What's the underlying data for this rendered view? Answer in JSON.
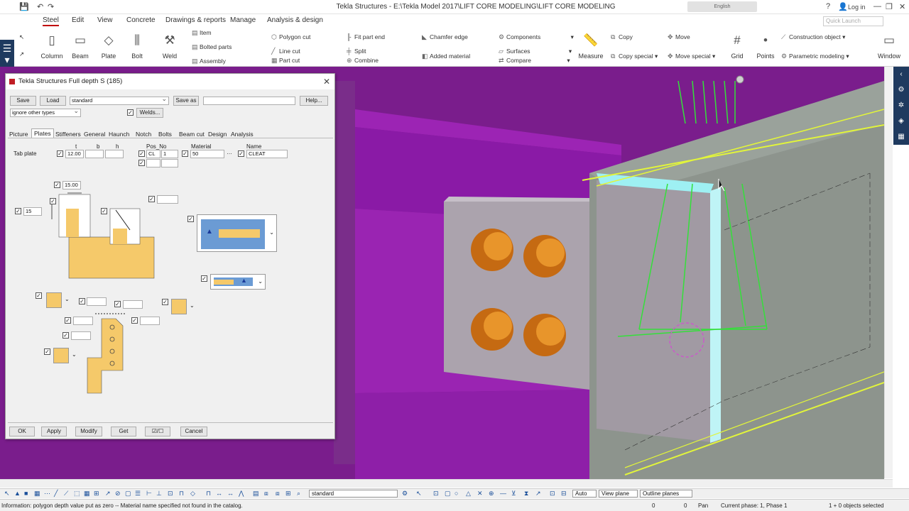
{
  "window": {
    "title": "Tekla Structures - E:\\Tekla Model 2017\\LIFT CORE MODELING\\LIFT CORE MODELING",
    "language": "English",
    "login": "Log in",
    "help": "?",
    "minimize": "—",
    "restore": "❐",
    "close": "✕"
  },
  "tabs": [
    "Steel",
    "Edit",
    "View",
    "Concrete",
    "Drawings & reports",
    "Manage",
    "Analysis & design"
  ],
  "search": {
    "placeholder": "Quick Launch"
  },
  "ribbon": {
    "big": [
      {
        "label": "Column",
        "icon": "column-icon",
        "glyph": "▯"
      },
      {
        "label": "Beam",
        "icon": "beam-icon",
        "glyph": "▭"
      },
      {
        "label": "Plate",
        "icon": "plate-icon",
        "glyph": "◇"
      },
      {
        "label": "Bolt",
        "icon": "bolt-icon",
        "glyph": "⫼"
      },
      {
        "label": "Weld",
        "icon": "weld-icon",
        "glyph": "⚒"
      },
      {
        "label": "Measure",
        "icon": "measure-icon",
        "glyph": "📏"
      },
      {
        "label": "Grid",
        "icon": "grid-icon",
        "glyph": "#"
      },
      {
        "label": "Points",
        "icon": "points-icon",
        "glyph": "•"
      },
      {
        "label": "Window",
        "icon": "window-icon",
        "glyph": "▭"
      }
    ],
    "small": {
      "item": "Item",
      "bolted_parts": "Bolted parts",
      "assembly": "Assembly",
      "polygon_cut": "Polygon cut",
      "line_cut": "Line cut",
      "part_cut": "Part cut",
      "fit_part_end": "Fit part end",
      "split": "Split",
      "combine": "Combine",
      "chamfer_edge": "Chamfer edge",
      "added_material": "Added material",
      "components": "Components",
      "surfaces": "Surfaces",
      "compare": "Compare",
      "copy": "Copy",
      "copy_special": "Copy special",
      "move": "Move",
      "move_special": "Move special",
      "construction_object": "Construction object",
      "parametric_modeling": "Parametric modeling"
    }
  },
  "dialog": {
    "title": "Tekla Structures  Full depth S (185)",
    "save": "Save",
    "load": "Load",
    "preset": "standard",
    "save_as": "Save as",
    "save_as_value": "",
    "help": "Help...",
    "ignore": "ignore other types",
    "welds": "Welds...",
    "tabs": [
      "Picture",
      "Plates",
      "Stiffeners",
      "General",
      "Haunch",
      "Notch",
      "Bolts",
      "Beam cut",
      "Design",
      "Analysis"
    ],
    "active_tab": "Plates",
    "col_t": "t",
    "col_b": "b",
    "col_h": "h",
    "col_pos": "Pos_No",
    "col_material": "Material",
    "col_name": "Name",
    "row_label": "Tab plate",
    "t_value": "12.00",
    "b_value": "",
    "h_value": "",
    "pos_prefix": "CL",
    "pos_start": "1",
    "material_value": "50",
    "name_value": "CLEAT",
    "pos_prefix2": "",
    "pos_start2": "",
    "dim_top": "15.00",
    "dim_left": "15",
    "dim_right": "",
    "ok": "OK",
    "apply": "Apply",
    "modify": "Modify",
    "get": "Get",
    "toggle": "☑/☐",
    "cancel": "Cancel"
  },
  "bottom_toolbar": {
    "selection_filter": "standard",
    "snap_mode": "Auto",
    "plane_mode": "View plane",
    "outline_mode": "Outline planes"
  },
  "status": {
    "message": "Information: polygon depth value put as zero -- Material name specified not found in the catalog.",
    "coord_x": "0",
    "coord_y": "0",
    "pan": "Pan",
    "phase": "Current phase: 1, Phase 1",
    "selected": "1 + 0 objects selected"
  },
  "colors": {
    "accent": "#c00000",
    "beam": "#8a1aa6",
    "plate": "#a9a2a9",
    "bolt": "#e08a1a",
    "weld": "#34e03a",
    "yellow_edge": "#e2f53a",
    "sidebar": "#1f3a5f"
  }
}
